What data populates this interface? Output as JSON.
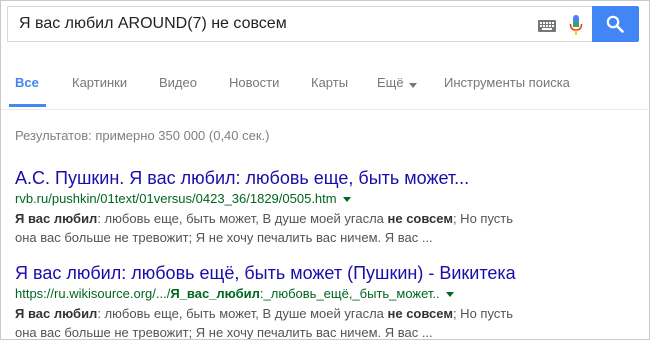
{
  "search": {
    "query": "Я вас любил AROUND(7) не совсем"
  },
  "tabs": [
    {
      "label": "Все",
      "active": true
    },
    {
      "label": "Картинки"
    },
    {
      "label": "Видео"
    },
    {
      "label": "Новости"
    },
    {
      "label": "Карты"
    },
    {
      "label": "Ещё"
    },
    {
      "label": "Инструменты поиска"
    }
  ],
  "stats": "Результатов: примерно 350 000 (0,40 сек.)",
  "results": [
    {
      "title": "А.С. Пушкин. Я вас любил: любовь еще, быть может...",
      "url": "rvb.ru/pushkin/01text/01versus/0423_36/1829/0505.htm",
      "snippet_parts": [
        "Я вас любил",
        ": любовь еще, быть может, В душе моей угасла ",
        "не совсем",
        "; Но пусть она вас больше не тревожит; Я не хочу печалить вас ничем. Я вас ..."
      ]
    },
    {
      "title": "Я вас любил: любовь ещё, быть может (Пушкин) - Викитека",
      "url_parts": [
        "https://ru.wikisource.org/.../",
        "Я_вас_любил",
        ":_любовь_ещё,_быть_может.."
      ],
      "snippet_parts": [
        "Я вас любил",
        ": любовь еще, быть может, В душе моей угасла ",
        "не совсем",
        "; Но пусть она вас больше не тревожит; Я не хочу печалить вас ничем. Я вас ..."
      ]
    }
  ],
  "colors": {
    "accent": "#4285f4",
    "link": "#1a0dab",
    "url": "#006621",
    "snippet": "#545454"
  },
  "icons": [
    "keyboard-icon",
    "microphone-icon",
    "search-icon",
    "chevron-down-icon"
  ]
}
